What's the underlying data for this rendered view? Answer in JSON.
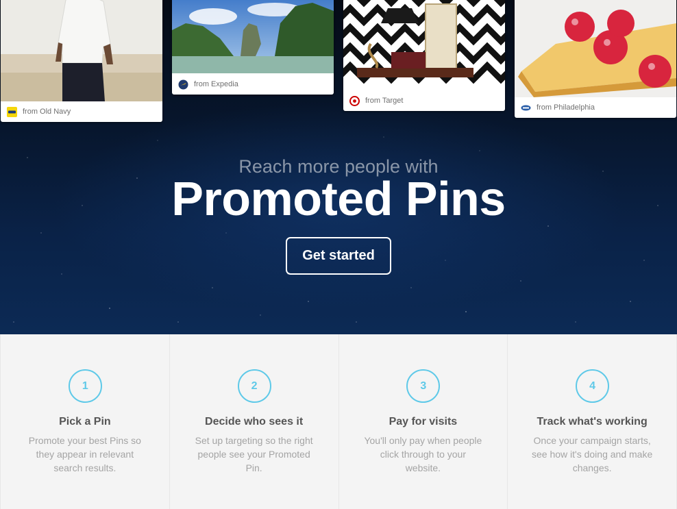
{
  "pins": [
    {
      "source": "from Old Navy",
      "logo": "old-navy-logo"
    },
    {
      "source": "from Expedia",
      "logo": "expedia-logo"
    },
    {
      "source": "from Target",
      "logo": "target-logo"
    },
    {
      "source": "from Philadelphia",
      "logo": "philadelphia-logo"
    }
  ],
  "hero": {
    "subtitle": "Reach more people with",
    "title": "Promoted Pins",
    "cta_label": "Get started"
  },
  "steps": [
    {
      "number": "1",
      "title": "Pick a Pin",
      "description": "Promote your best Pins so they appear in relevant search results."
    },
    {
      "number": "2",
      "title": "Decide who sees it",
      "description": "Set up targeting so the right people see your Promoted Pin."
    },
    {
      "number": "3",
      "title": "Pay for visits",
      "description": "You'll only pay when people click through to your website."
    },
    {
      "number": "4",
      "title": "Track what's working",
      "description": "Once your campaign starts, see how it's doing and make changes."
    }
  ],
  "colors": {
    "accent": "#5ec9e8",
    "hero_background": "#0a2247",
    "steps_background": "#f4f4f4"
  }
}
